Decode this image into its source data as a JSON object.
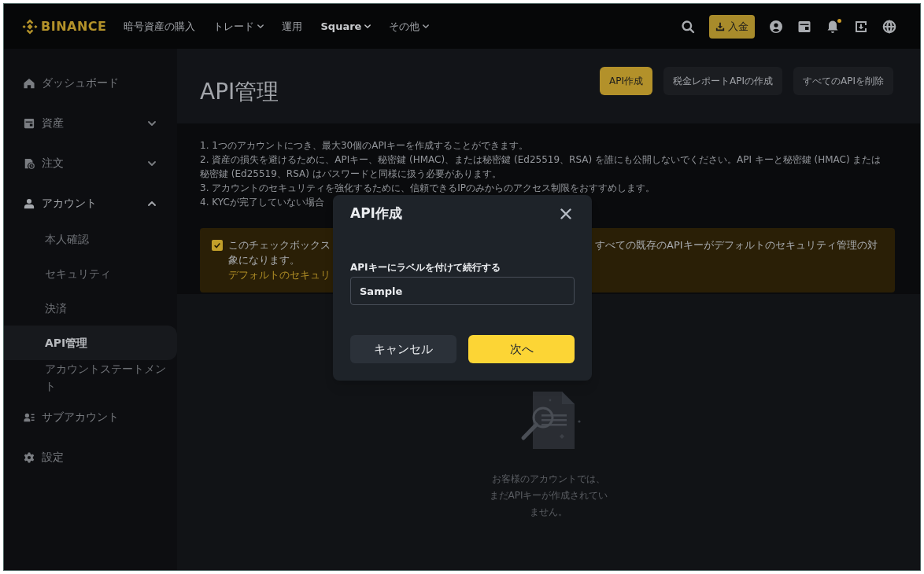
{
  "nav": {
    "logo": "BINANCE",
    "items": [
      {
        "label": "暗号資産の購入",
        "dropdown": false,
        "emphasized": false
      },
      {
        "label": "トレード",
        "dropdown": true,
        "emphasized": false
      },
      {
        "label": "運用",
        "dropdown": false,
        "emphasized": false
      },
      {
        "label": "Square",
        "dropdown": true,
        "emphasized": true
      },
      {
        "label": "その他",
        "dropdown": true,
        "emphasized": false
      }
    ],
    "deposit_button": "入金",
    "notification_dot": true
  },
  "sidebar": {
    "items": [
      {
        "label": "ダッシュボード",
        "selected": false
      },
      {
        "label": "資産",
        "selected": false,
        "expanded": false
      },
      {
        "label": "注文",
        "selected": false,
        "expanded": false
      },
      {
        "label": "アカウント",
        "selected": false,
        "expanded": true,
        "children": [
          {
            "label": "本人確認",
            "selected": false
          },
          {
            "label": "セキュリティ",
            "selected": false
          },
          {
            "label": "決済",
            "selected": false
          },
          {
            "label": "API管理",
            "selected": true
          },
          {
            "label": "アカウントステートメント",
            "selected": false
          }
        ]
      },
      {
        "label": "サブアカウント",
        "selected": false
      },
      {
        "label": "設定",
        "selected": false
      }
    ]
  },
  "header": {
    "title": "API管理",
    "actions": [
      {
        "label": "API作成",
        "primary": true
      },
      {
        "label": "税金レポートAPIの作成",
        "primary": false
      },
      {
        "label": "すべてのAPIを削除",
        "primary": false
      }
    ]
  },
  "notes": [
    "1. 1つのアカウントにつき、最大30個のAPIキーを作成することができます。",
    "2. 資産の損失を避けるために、APIキー、秘密鍵 (HMAC)、または秘密鍵 (Ed25519、RSA) を誰にも公開しないでください。API キーと秘密鍵 (HMAC) または秘密鍵 (Ed25519、RSA) はパスワードと同様に扱う必要があります。",
    "3. アカウントのセキュリティを強化するために、信頼できるIPのみからのアクセス制限をおすすめします。",
    "4. KYCが完了していない場合"
  ],
  "warning": {
    "checked": true,
    "text_left": "このチェックボックス",
    "text_right": "すべての既存のAPIキーがデフォルトのセキュリティ管理の対",
    "text_line2": "象になります。",
    "link": "デフォルトのセキュリ"
  },
  "modal": {
    "title": "API作成",
    "field": {
      "label": "APIキーにラベルを付けて続行する",
      "value": "Sample"
    },
    "buttons": [
      {
        "label": "キャンセル",
        "primary": false
      },
      {
        "label": "次へ",
        "primary": true
      }
    ]
  },
  "empty_state": {
    "message": "お客様のアカウントでは、まだAPIキーが作成されていません。"
  }
}
